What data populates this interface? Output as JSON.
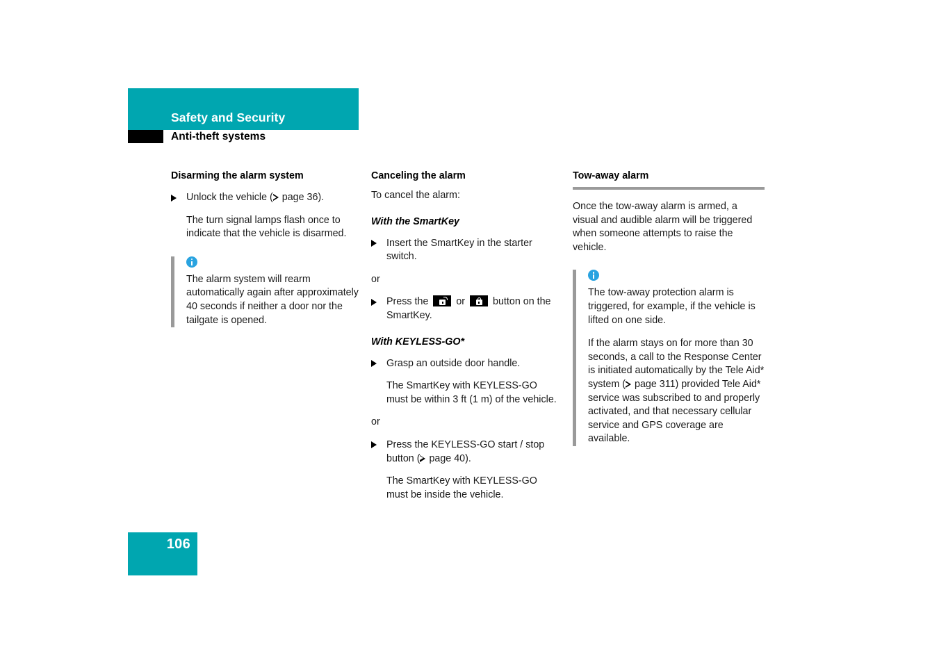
{
  "header": {
    "band_title": "Safety and Security",
    "subtitle": "Anti-theft systems"
  },
  "colors": {
    "brand_teal": "#00a6b0",
    "info_blue": "#29a3e0",
    "rule_gray": "#9a9a9a",
    "black_tab": "#000000"
  },
  "columns": {
    "left": {
      "section_title": "Disarming the alarm system",
      "step_1": "Unlock the vehicle (",
      "step_1_ref": " page 36).",
      "step_1_result": "The turn signal lamps flash once to indicate that the vehicle is disarmed.",
      "note": {
        "icon": "info-icon",
        "text": "The alarm system will rearm automatically again after approximately 40 seconds if neither a door nor the tailgate is opened."
      }
    },
    "middle": {
      "section_title": "Canceling the alarm",
      "intro": "To cancel the alarm:",
      "subhead_smartkey": "With the SmartKey",
      "step_1": "Insert the SmartKey in the starter switch.",
      "or_1": "or",
      "step_2_pre": "Press the ",
      "step_2_mid": " or ",
      "step_2_post": " button on the SmartKey.",
      "icon_unlock": "unlock-button-icon",
      "icon_lock": "lock-button-icon",
      "subhead_keylessgo": "With KEYLESS-GO*",
      "step_3": "Grasp an outside door handle.",
      "step_3_result": "The SmartKey with KEYLESS-GO must be within 3 ft (1 m) of the vehicle.",
      "or_2": "or",
      "step_4_pre": "Press the KEYLESS-GO start / stop button (",
      "step_4_ref": " page 40).",
      "step_4_result": "The SmartKey with KEYLESS-GO must be inside the vehicle."
    },
    "right": {
      "section_title": "Tow-away alarm",
      "intro": "Once the tow-away alarm is armed, a visual and audible alarm will be triggered when someone attempts to raise the vehicle.",
      "note": {
        "icon": "info-icon",
        "para_1": "The tow-away protection alarm is triggered, for example, if the vehicle is lifted on one side.",
        "para_2_pre": "If the alarm stays on for more than 30 seconds, a call to the Response Center is initiated automatically by the Tele Aid* system (",
        "para_2_post": " page 311) provided Tele Aid* service was subscribed to and properly activated, and that necessary cellular service and GPS coverage are available."
      }
    }
  },
  "footer": {
    "page_number": "106"
  }
}
